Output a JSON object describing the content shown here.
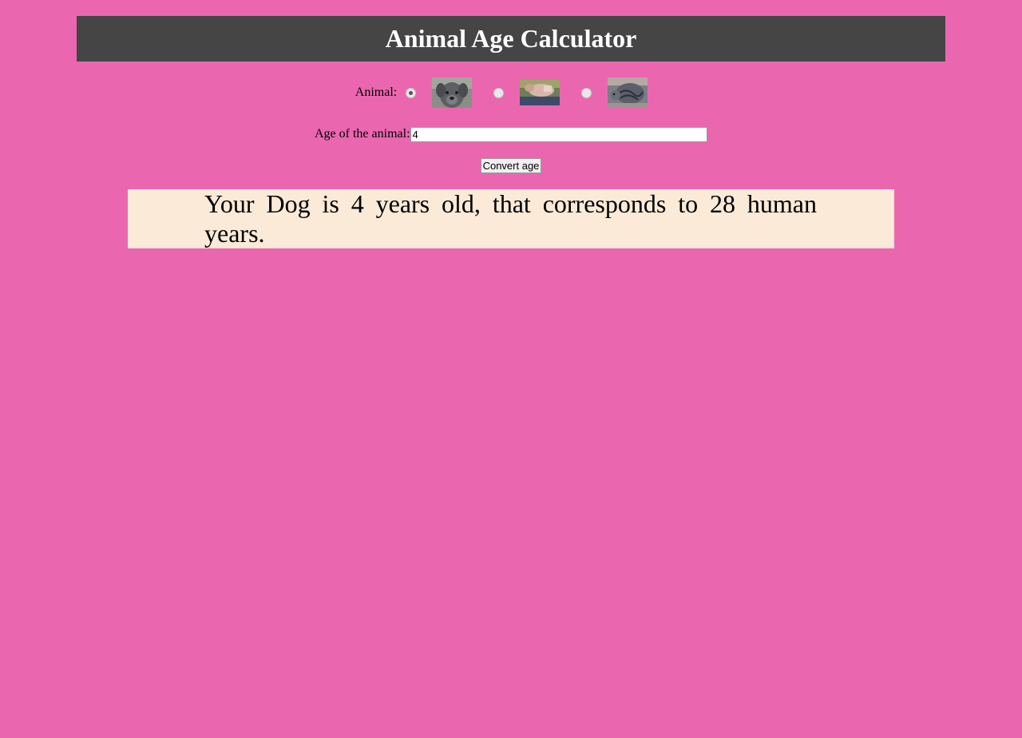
{
  "header": {
    "title": "Animal Age Calculator"
  },
  "form": {
    "animal_label": "Animal:",
    "animals": [
      {
        "name": "Dog",
        "icon": "dog-photo",
        "selected": true
      },
      {
        "name": "Pig",
        "icon": "pig-photo",
        "selected": false
      },
      {
        "name": "Cat",
        "icon": "cat-photo",
        "selected": false
      }
    ],
    "age_label": "Age of the animal:",
    "age_value": "4",
    "convert_label": "Convert age"
  },
  "result": {
    "text": "Your Dog is 4 years old, that corresponds to 28 human years."
  },
  "colors": {
    "background": "#ea67b0",
    "header_bg": "#454545",
    "header_text": "#ffffff",
    "result_bg": "#fbead7"
  }
}
